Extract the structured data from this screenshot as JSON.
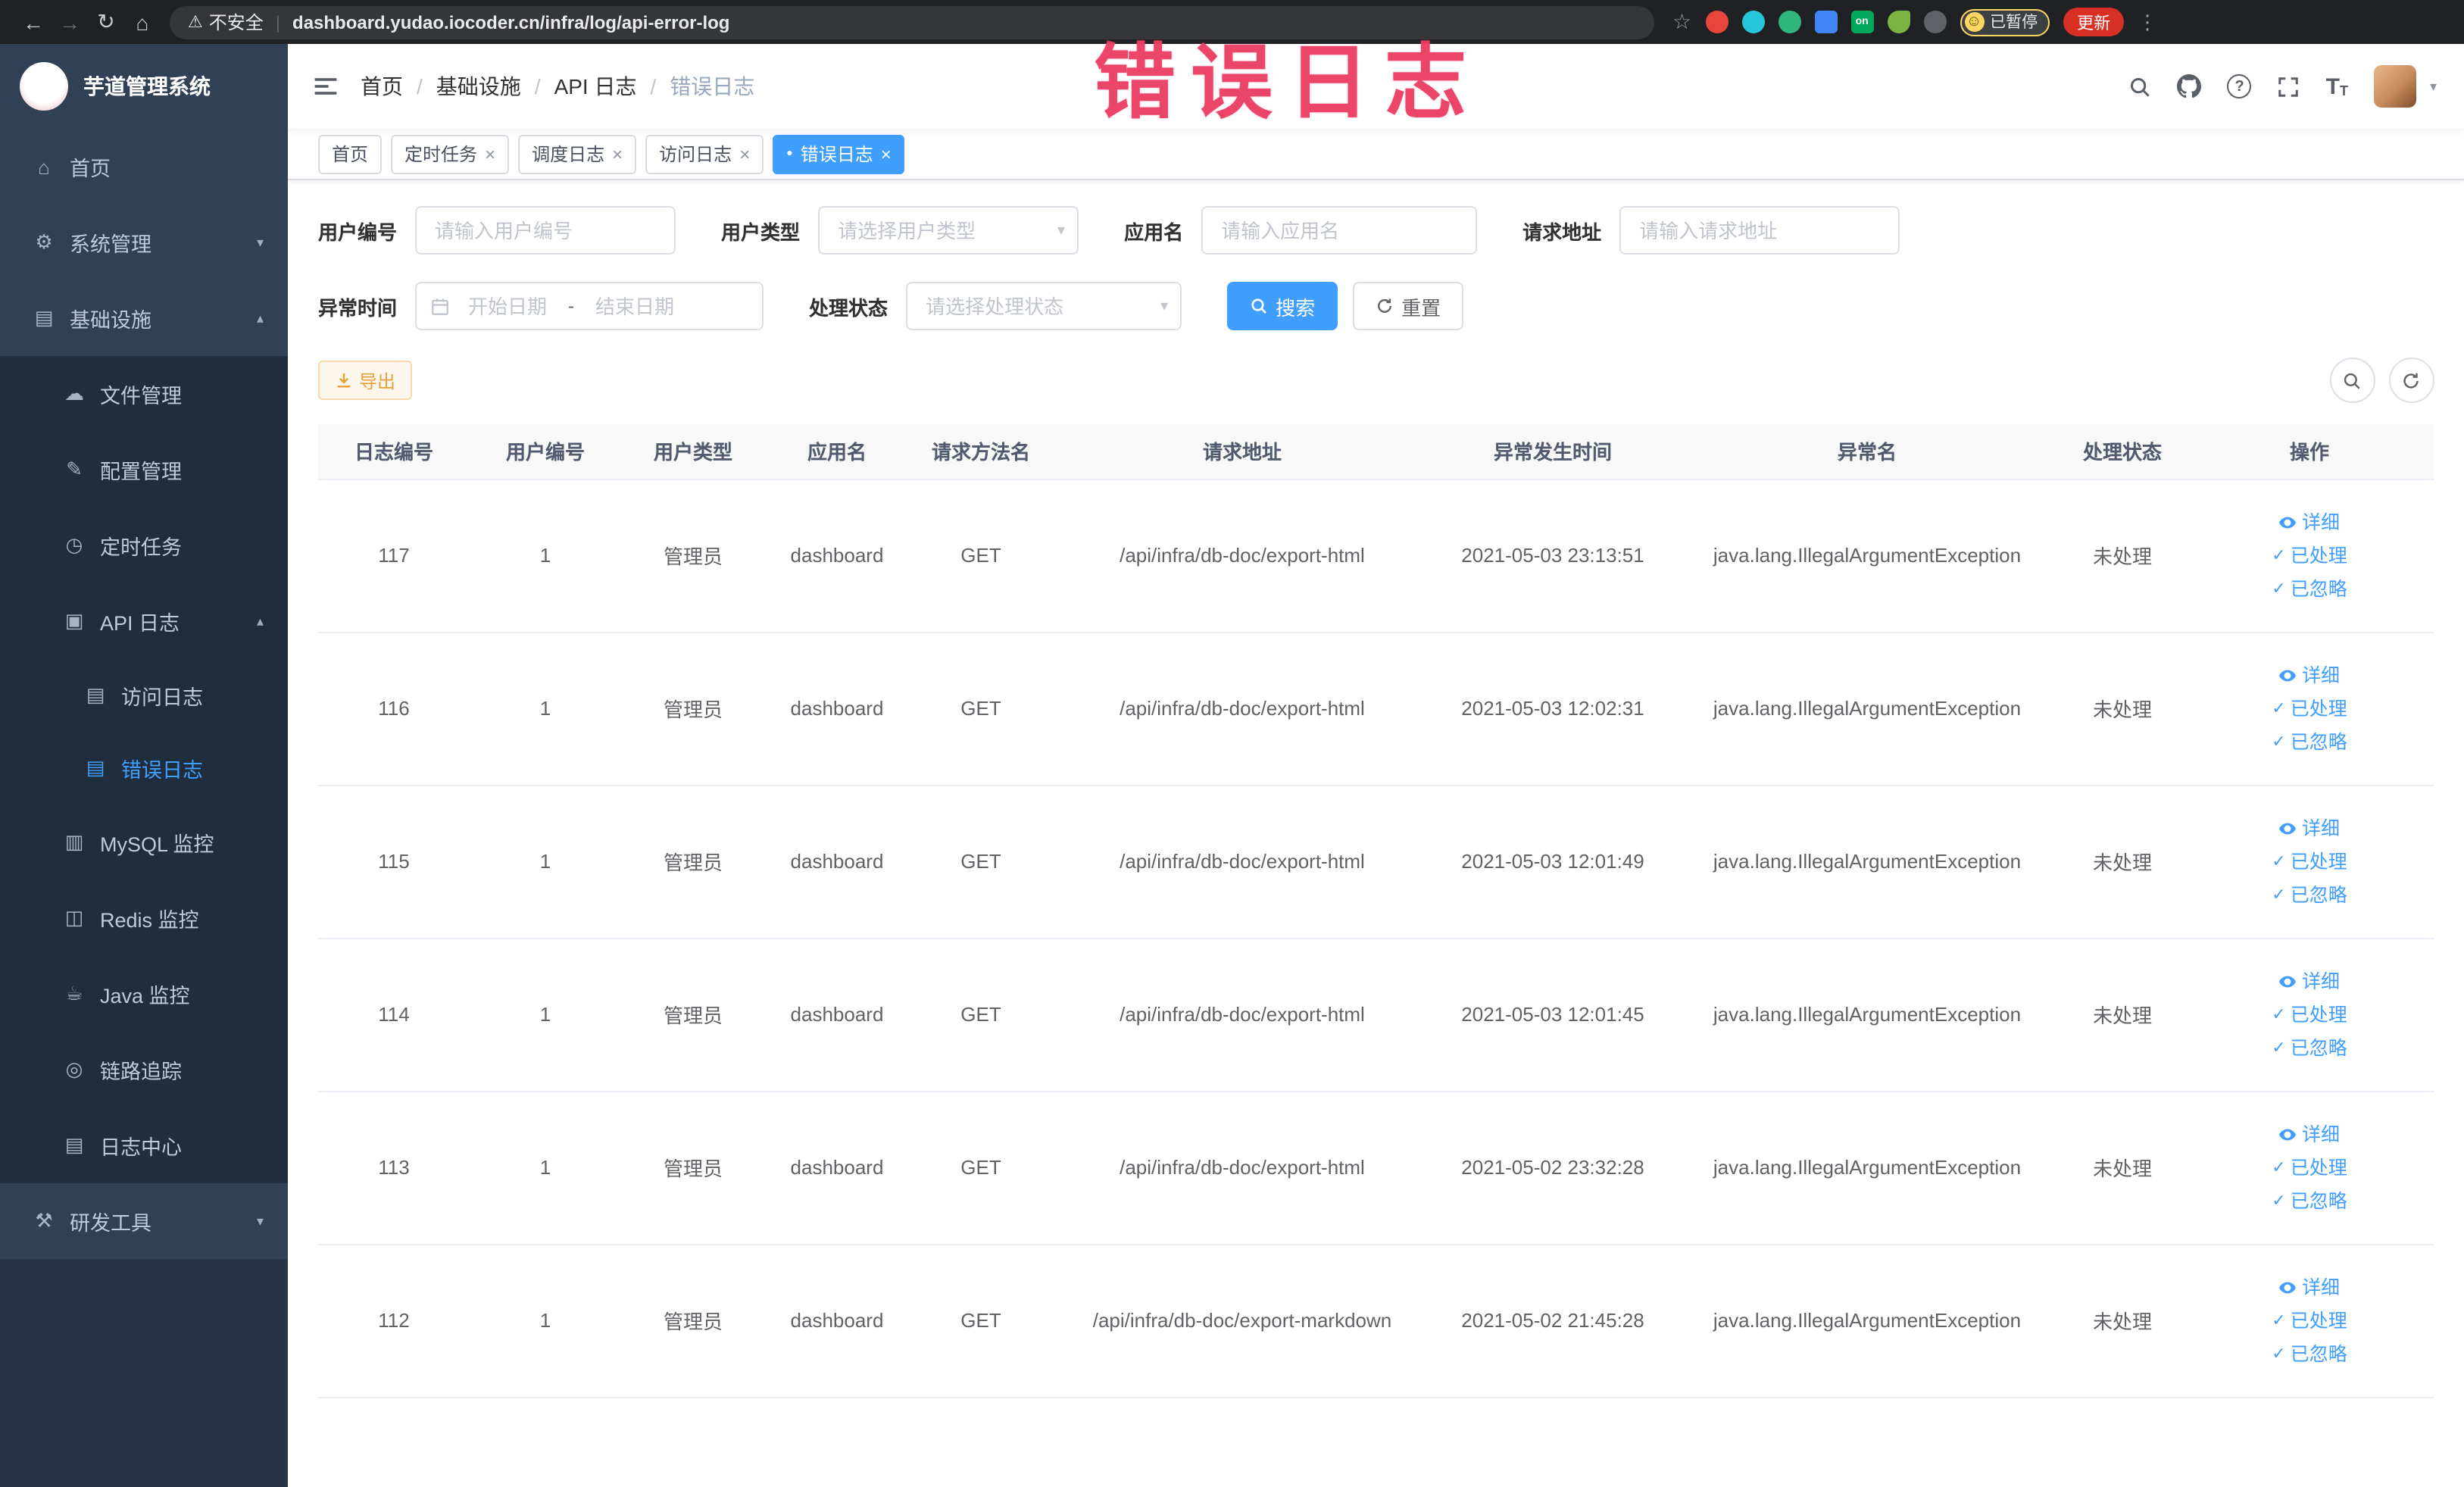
{
  "browser": {
    "security_label": "不安全",
    "url": "dashboard.yudao.iocoder.cn/infra/log/api-error-log",
    "on_badge": "on",
    "paused_badge": "已暂停",
    "update_button": "更新"
  },
  "overlay_text": "错误日志",
  "navbar": {
    "breadcrumb": [
      "首页",
      "基础设施",
      "API 日志",
      "错误日志"
    ],
    "separator": "/"
  },
  "sidebar": {
    "logo_title": "芋道管理系统",
    "home": "首页",
    "system_mgmt": "系统管理",
    "infrastructure": "基础设施",
    "file_mgmt": "文件管理",
    "config_mgmt": "配置管理",
    "scheduled_jobs": "定时任务",
    "api_log": "API 日志",
    "access_log": "访问日志",
    "error_log": "错误日志",
    "mysql_monitor": "MySQL 监控",
    "redis_monitor": "Redis 监控",
    "java_monitor": "Java 监控",
    "trace": "链路追踪",
    "log_center": "日志中心",
    "dev_tools": "研发工具"
  },
  "tabs": [
    {
      "label": "首页"
    },
    {
      "label": "定时任务"
    },
    {
      "label": "调度日志"
    },
    {
      "label": "访问日志"
    },
    {
      "label": "错误日志"
    }
  ],
  "filters": {
    "user_id": {
      "label": "用户编号",
      "placeholder": "请输入用户编号"
    },
    "user_type": {
      "label": "用户类型",
      "placeholder": "请选择用户类型"
    },
    "app_name": {
      "label": "应用名",
      "placeholder": "请输入应用名"
    },
    "request_url": {
      "label": "请求地址",
      "placeholder": "请输入请求地址"
    },
    "exception_time": {
      "label": "异常时间",
      "start_placeholder": "开始日期",
      "separator": "-",
      "end_placeholder": "结束日期"
    },
    "process_status": {
      "label": "处理状态",
      "placeholder": "请选择处理状态"
    },
    "search_button": "搜索",
    "reset_button": "重置"
  },
  "toolbar": {
    "export_button": "导出"
  },
  "table": {
    "headers": [
      "日志编号",
      "用户编号",
      "用户类型",
      "应用名",
      "请求方法名",
      "请求地址",
      "异常发生时间",
      "异常名",
      "处理状态",
      "操作"
    ],
    "actions": {
      "detail": "详细",
      "processed": "已处理",
      "ignored": "已忽略"
    },
    "rows": [
      {
        "id": "117",
        "user_id": "1",
        "user_type": "管理员",
        "app": "dashboard",
        "method": "GET",
        "url": "/api/infra/db-doc/export-html",
        "time": "2021-05-03 23:13:51",
        "exception": "java.lang.IllegalArgumentException",
        "status": "未处理"
      },
      {
        "id": "116",
        "user_id": "1",
        "user_type": "管理员",
        "app": "dashboard",
        "method": "GET",
        "url": "/api/infra/db-doc/export-html",
        "time": "2021-05-03 12:02:31",
        "exception": "java.lang.IllegalArgumentException",
        "status": "未处理"
      },
      {
        "id": "115",
        "user_id": "1",
        "user_type": "管理员",
        "app": "dashboard",
        "method": "GET",
        "url": "/api/infra/db-doc/export-html",
        "time": "2021-05-03 12:01:49",
        "exception": "java.lang.IllegalArgumentException",
        "status": "未处理"
      },
      {
        "id": "114",
        "user_id": "1",
        "user_type": "管理员",
        "app": "dashboard",
        "method": "GET",
        "url": "/api/infra/db-doc/export-html",
        "time": "2021-05-03 12:01:45",
        "exception": "java.lang.IllegalArgumentException",
        "status": "未处理"
      },
      {
        "id": "113",
        "user_id": "1",
        "user_type": "管理员",
        "app": "dashboard",
        "method": "GET",
        "url": "/api/infra/db-doc/export-html",
        "time": "2021-05-02 23:32:28",
        "exception": "java.lang.IllegalArgumentException",
        "status": "未处理"
      },
      {
        "id": "112",
        "user_id": "1",
        "user_type": "管理员",
        "app": "dashboard",
        "method": "GET",
        "url": "/api/infra/db-doc/export-markdown",
        "time": "2021-05-02 21:45:28",
        "exception": "java.lang.IllegalArgumentException",
        "status": "未处理"
      }
    ]
  },
  "colors": {
    "accent": "#409eff",
    "sidebar_bg": "#304156",
    "submenu_bg": "#1f2d3d",
    "warning": "#e6a23c",
    "overlay_annotation": "#ea3d63"
  },
  "icons": {
    "back": "←",
    "forward": "→",
    "reload": "↻",
    "home": "⌂",
    "warning": "⚠",
    "divider": "|",
    "star": "☆",
    "kebab": "⋮",
    "emoji": "☺",
    "close": "×",
    "dot": "●",
    "caret_down": "▾",
    "caret_up": "▴",
    "check": "✓",
    "question": "?",
    "text_size": "T",
    "menu_home": "⌂",
    "menu_system": "⚙",
    "menu_infra": "▤",
    "menu_file": "☁",
    "menu_config": "✎",
    "menu_job": "◷",
    "menu_api": "▣",
    "menu_log": "▤",
    "menu_mysql": "▥",
    "menu_redis": "◫",
    "menu_java": "☕",
    "menu_trace": "◎",
    "menu_logcenter": "▤",
    "menu_tools": "⚒"
  }
}
